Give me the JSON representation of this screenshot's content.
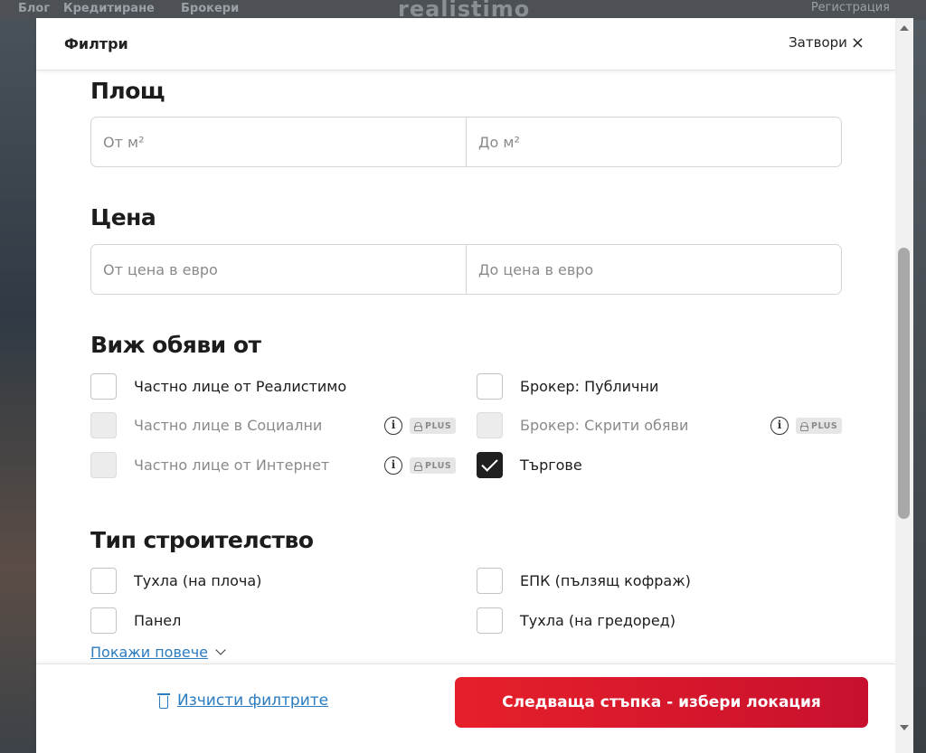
{
  "background": {
    "nav_items": [
      "Блог",
      "Кредитиране",
      "Брокери"
    ],
    "logo": "realistimo",
    "right_text": "Регистрация"
  },
  "modal": {
    "title": "Филтри",
    "close_label": "Затвори",
    "close_icon": "×"
  },
  "area": {
    "title": "Площ",
    "from_placeholder": "От м²",
    "to_placeholder": "До м²"
  },
  "price": {
    "title": "Цена",
    "from_placeholder": "От цена в евро",
    "to_placeholder": "До цена в евро"
  },
  "listings_from": {
    "title": "Виж обяви от",
    "options": [
      {
        "label": "Частно лице от Реалистимо",
        "checked": false,
        "disabled": false
      },
      {
        "label": "Частно лице в Социални",
        "checked": false,
        "disabled": true,
        "badge": "PLUS"
      },
      {
        "label": "Частно лице от Интернет",
        "checked": false,
        "disabled": true,
        "badge": "PLUS"
      },
      {
        "label": "Брокер: Публични",
        "checked": false,
        "disabled": false
      },
      {
        "label": "Брокер: Скрити обяви",
        "checked": false,
        "disabled": true,
        "badge": "PLUS"
      },
      {
        "label": "Търгове",
        "checked": true,
        "disabled": false
      }
    ]
  },
  "construction": {
    "title": "Тип строителство",
    "options": [
      {
        "label": "Тухла (на плоча)",
        "checked": false
      },
      {
        "label": "Панел",
        "checked": false
      },
      {
        "label": "ЕПК (пълзящ кофраж)",
        "checked": false
      },
      {
        "label": "Тухла (на гредоред)",
        "checked": false
      }
    ],
    "show_more": "Покажи повече"
  },
  "footer": {
    "clear_label": "Изчисти филтрите",
    "next_label": "Следваща стъпка - избери локация"
  },
  "colors": {
    "accent_red": "#e6202a",
    "link_blue": "#2a7bc0",
    "checked_dark": "#1f1f1f"
  },
  "icons": {
    "info": "i",
    "badge": "PLUS"
  }
}
